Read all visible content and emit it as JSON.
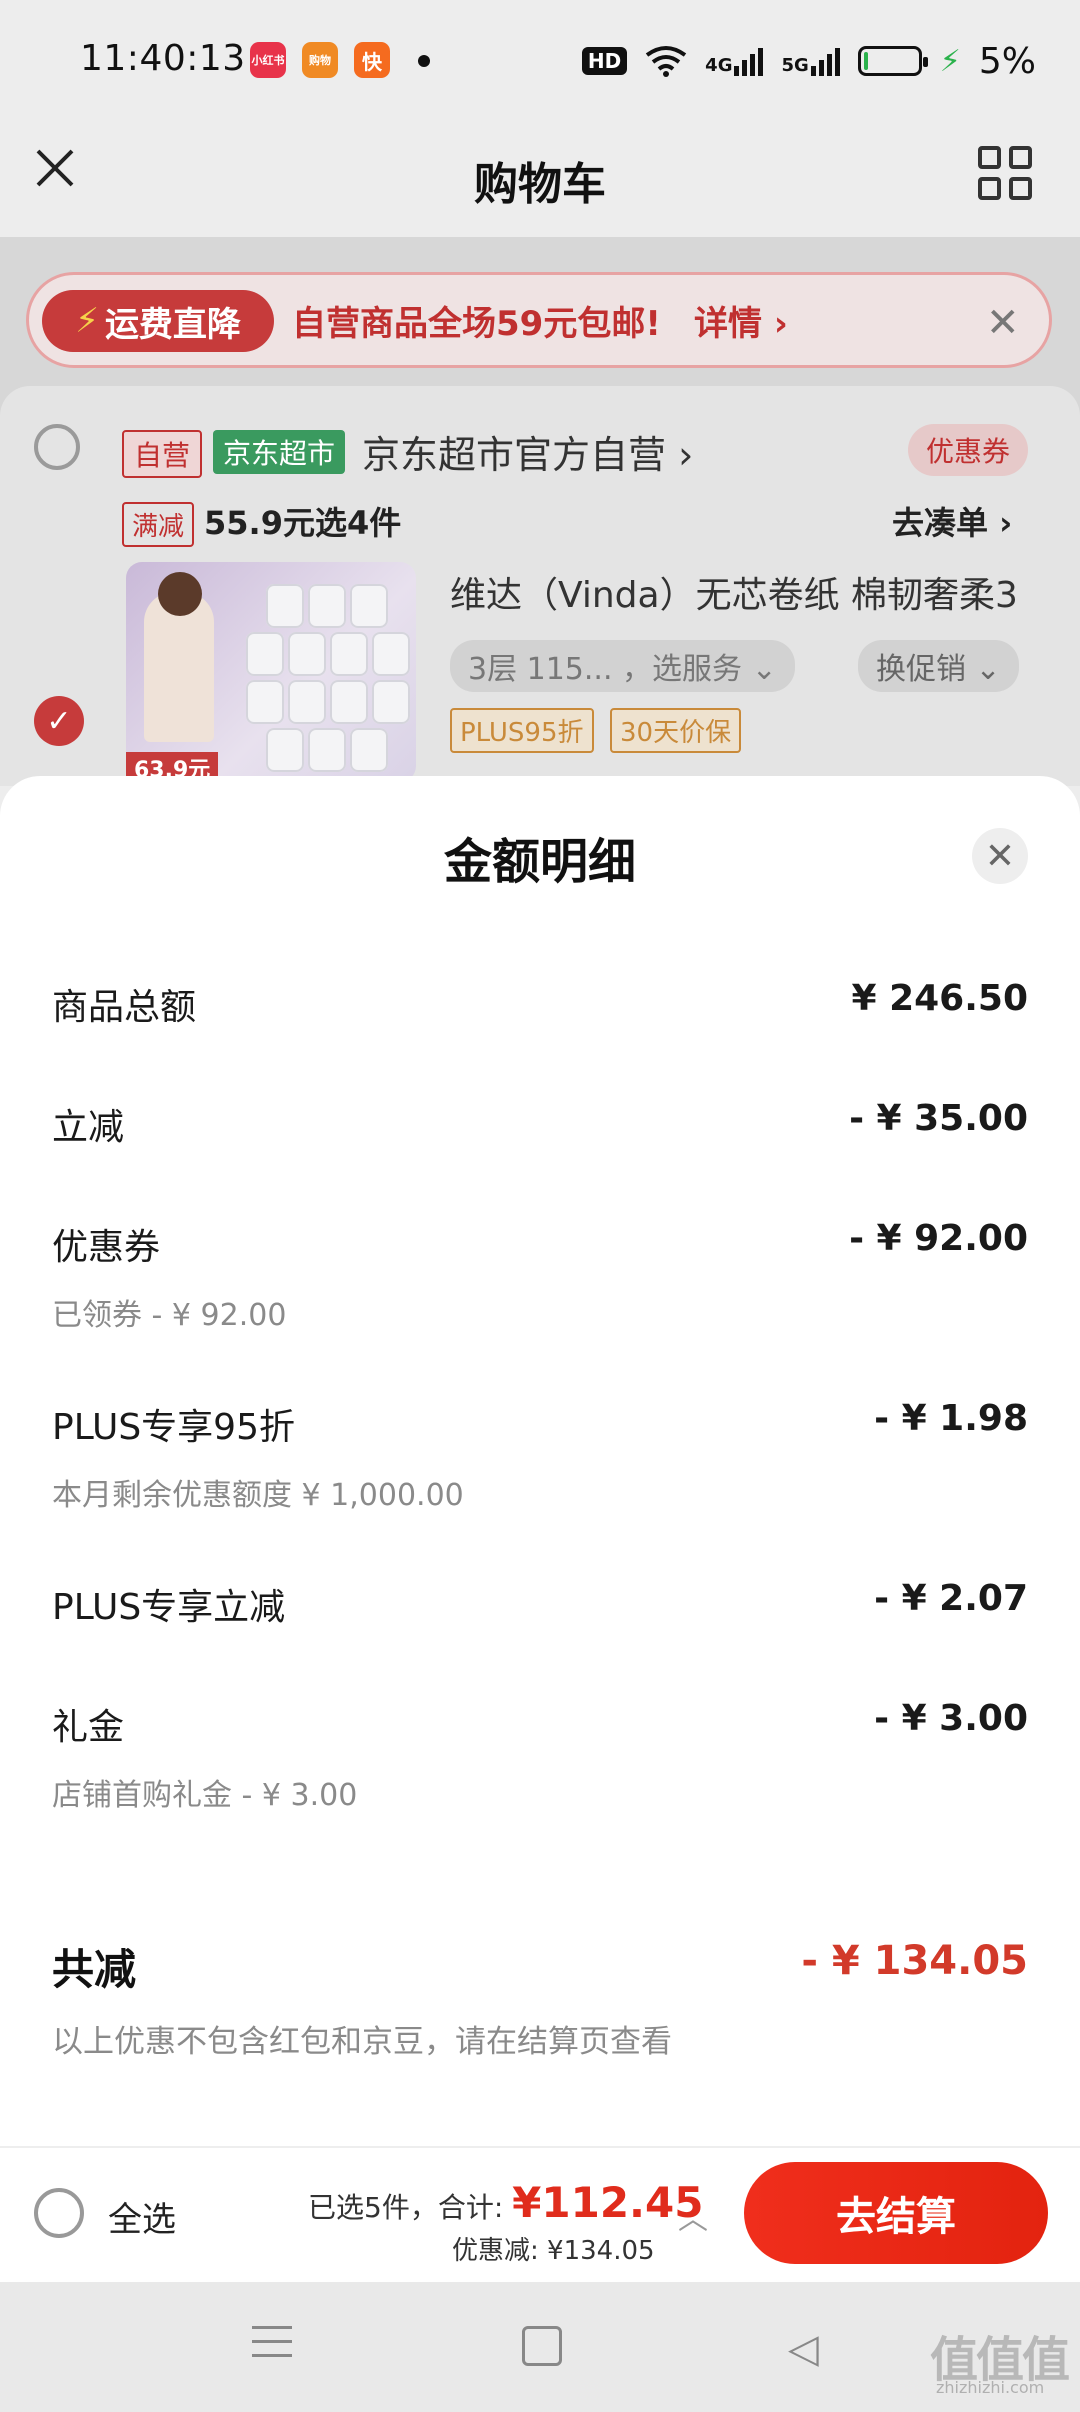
{
  "status_bar": {
    "time": "11:40:13",
    "apps": [
      {
        "name": "xiaohongshu-app-icon",
        "label": "小红书",
        "color": "#e8334a"
      },
      {
        "name": "gouwu-app-icon",
        "label": "购物",
        "color": "#f08a24"
      },
      {
        "name": "kuaishou-app-icon",
        "label": "快",
        "color": "#f56b1f"
      }
    ],
    "hd": "HD",
    "net1": "4G",
    "net2": "5G",
    "battery": "5%"
  },
  "header": {
    "title": "购物车"
  },
  "banner": {
    "tag": "运费直降",
    "text": "自营商品全场59元包邮!",
    "detail": "详情 ›"
  },
  "shop": {
    "tag_ziying": "自营",
    "tag_chaoshi": "京东超市",
    "name": "京东超市官方自营 ›",
    "coupon": "优惠券",
    "promo_tag": "满减",
    "promo_text": "55.9元选4件",
    "go_order": "去凑单 ›"
  },
  "product": {
    "title": "维达（Vinda）无芯卷纸 棉韧奢柔3",
    "spec": "3层 115...  ，选服务 ⌄",
    "swap": "换促销 ⌄",
    "tag_plus": "PLUS95折",
    "tag_price": "30天价保",
    "price_tag": "63.9元"
  },
  "sheet": {
    "title": "金额明细",
    "rows": [
      {
        "label": "商品总额",
        "value": "¥ 246.50"
      },
      {
        "label": "立减",
        "value": "- ¥ 35.00"
      },
      {
        "label": "优惠券",
        "value": "- ¥ 92.00",
        "sub": "已领券 - ¥ 92.00"
      },
      {
        "label": "PLUS专享95折",
        "value": "- ¥ 1.98",
        "sub": "本月剩余优惠额度  ¥ 1,000.00"
      },
      {
        "label": "PLUS专享立减",
        "value": "- ¥ 2.07"
      },
      {
        "label": "礼金",
        "value": "- ¥ 3.00",
        "sub": "店铺首购礼金 - ¥ 3.00"
      }
    ],
    "total_label": "共减",
    "total_value": "- ¥ 134.05",
    "note": "以上优惠不包含红包和京豆，请在结算页查看"
  },
  "checkout": {
    "select_all": "全选",
    "summary_prefix": "已选5件，合计:",
    "summary_price": "¥112.45",
    "discount": "优惠减:  ¥134.05",
    "button": "去结算"
  },
  "watermark": {
    "main": "值值值",
    "sub": "zhizhizhi.com"
  },
  "colors": {
    "accent": "#e02c1c",
    "muted": "#8a8a8a",
    "green": "#3a9a5f"
  }
}
